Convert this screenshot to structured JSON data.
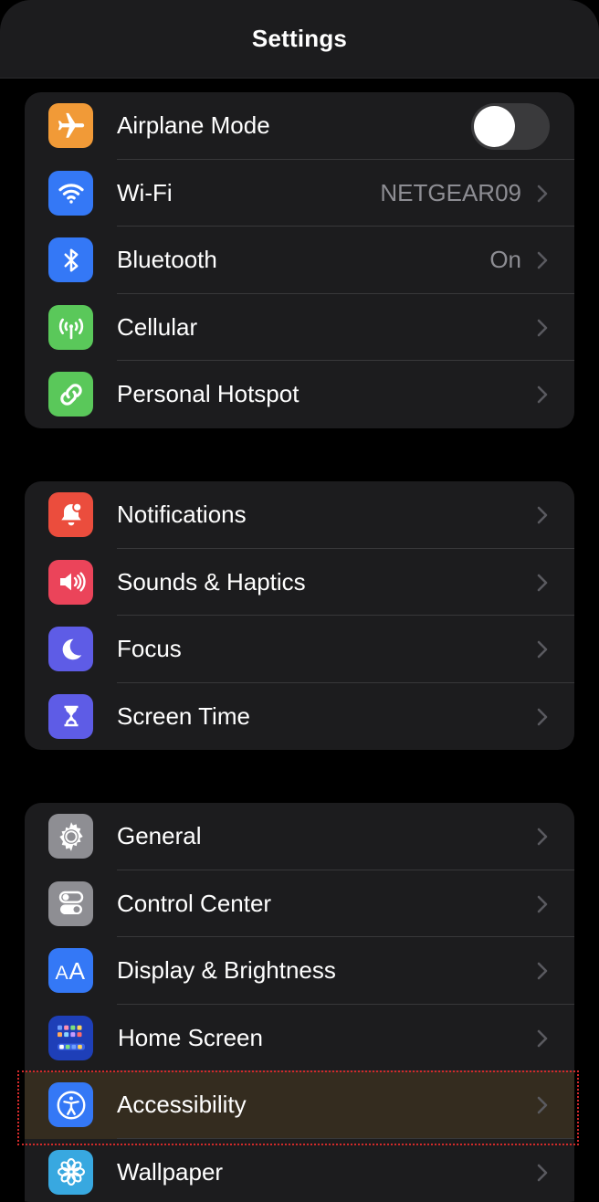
{
  "navbar": {
    "title": "Settings"
  },
  "group1": {
    "airplane": {
      "label": "Airplane Mode",
      "icon": "airplane-icon",
      "color": "#f19a37",
      "toggle_on": false
    },
    "wifi": {
      "label": "Wi-Fi",
      "value": "NETGEAR09",
      "icon": "wifi-icon",
      "color": "#3478f6"
    },
    "bluetooth": {
      "label": "Bluetooth",
      "value": "On",
      "icon": "bluetooth-icon",
      "color": "#3478f6"
    },
    "cellular": {
      "label": "Cellular",
      "icon": "antenna-icon",
      "color": "#5ac85a"
    },
    "hotspot": {
      "label": "Personal Hotspot",
      "icon": "link-icon",
      "color": "#5ac85a"
    }
  },
  "group2": {
    "notifications": {
      "label": "Notifications",
      "icon": "bell-icon",
      "color": "#eb4d3d"
    },
    "sounds": {
      "label": "Sounds & Haptics",
      "icon": "speaker-icon",
      "color": "#eb445a"
    },
    "focus": {
      "label": "Focus",
      "icon": "moon-icon",
      "color": "#5e5ce6"
    },
    "screentime": {
      "label": "Screen Time",
      "icon": "hourglass-icon",
      "color": "#5e5ce6"
    }
  },
  "group3": {
    "general": {
      "label": "General",
      "icon": "gear-icon",
      "color": "#8e8e93"
    },
    "control": {
      "label": "Control Center",
      "icon": "switches-icon",
      "color": "#8e8e93"
    },
    "display": {
      "label": "Display & Brightness",
      "icon": "text-size-icon",
      "color": "#3478f6"
    },
    "homescreen": {
      "label": "Home Screen",
      "icon": "app-grid-icon",
      "color": "#2a54e0"
    },
    "accessibility": {
      "label": "Accessibility",
      "icon": "accessibility-icon",
      "color": "#3478f6",
      "highlighted": true
    },
    "wallpaper": {
      "label": "Wallpaper",
      "icon": "flower-icon",
      "color": "#38a8e0"
    }
  }
}
